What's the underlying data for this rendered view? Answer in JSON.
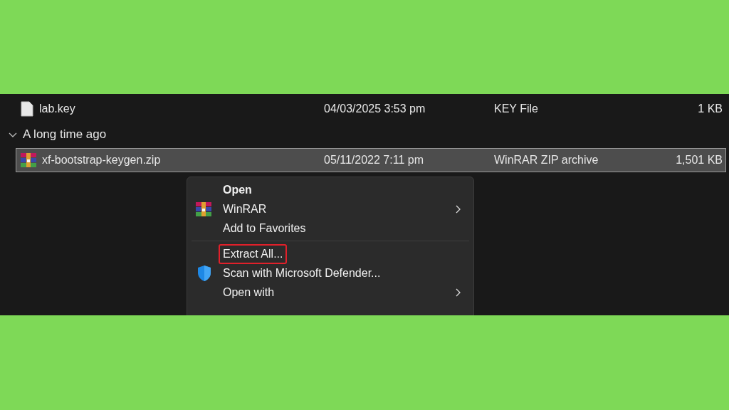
{
  "file_list": [
    {
      "kind": "document",
      "name": "lab.key",
      "date": "04/03/2025 3:53 pm",
      "type": "KEY File",
      "size": "1 KB",
      "selected": false
    },
    {
      "kind": "group",
      "label": "A long time ago",
      "expanded": true
    },
    {
      "kind": "archive",
      "name": "xf-bootstrap-keygen.zip",
      "date": "05/11/2022 7:11 pm",
      "type": "WinRAR ZIP archive",
      "size": "1,501 KB",
      "selected": true
    }
  ],
  "context_menu": {
    "items": [
      {
        "kind": "plain",
        "label": "Open",
        "bold": true,
        "submenu": false,
        "highlighted": false
      },
      {
        "kind": "archive",
        "label": "WinRAR",
        "bold": false,
        "submenu": true,
        "highlighted": false
      },
      {
        "kind": "plain",
        "label": "Add to Favorites",
        "bold": false,
        "submenu": false,
        "highlighted": false
      },
      {
        "kind": "separator"
      },
      {
        "kind": "plain",
        "label": "Extract All...",
        "bold": false,
        "submenu": false,
        "highlighted": true
      },
      {
        "kind": "shield",
        "label": "Scan with Microsoft Defender...",
        "bold": false,
        "submenu": false,
        "highlighted": false
      },
      {
        "kind": "plain",
        "label": "Open with",
        "bold": false,
        "submenu": true,
        "highlighted": false
      }
    ]
  }
}
